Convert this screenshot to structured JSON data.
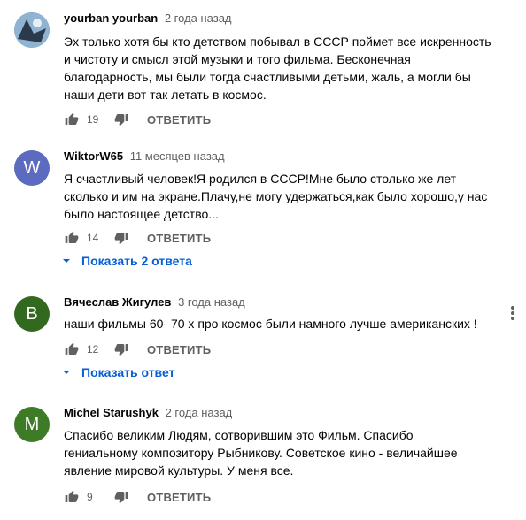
{
  "comments": [
    {
      "author": "yourban yourban",
      "date": "2 года назад",
      "avatar_letter": "",
      "avatar_color": "#7b9bb8",
      "text": "Эх только хотя бы кто детством побывал в СССР поймет все искренность\nи чистоту и смысл этой музыки и того фильма. Бесконечная\nблагодарность, мы были тогда счастливыми детьми, жаль, а могли бы\nнаши дети вот так летать в космос.",
      "likes": "19",
      "reply_label": "ОТВЕТИТЬ"
    },
    {
      "author": "WiktorW65",
      "date": "11 месяцев назад",
      "avatar_letter": "W",
      "avatar_color": "#5c6bc0",
      "text": "Я счастливый человек!Я родился в СССР!Мне было столько же лет\nсколько и им на экране.Плачу,не могу удержаться,как было хорошо,у нас\nбыло настоящее детство...",
      "likes": "14",
      "reply_label": "ОТВЕТИТЬ",
      "show_replies": "Показать 2 ответа"
    },
    {
      "author": "Вячеслав Жигулев",
      "date": "3 года назад",
      "avatar_letter": "В",
      "avatar_color": "#33691e",
      "text": "наши фильмы 60- 70 х  про космос были намного лучше американских !",
      "likes": "12",
      "reply_label": "ОТВЕТИТЬ",
      "show_replies": "Показать ответ"
    },
    {
      "author": "Michel Starushyk",
      "date": "2 года назад",
      "avatar_letter": "M",
      "avatar_color": "#3e7b27",
      "text": "Спасибо великим Людям, сотворившим это Фильм. Спасибо\nгениальному композитору Рыбникову. Советское кино - величайшее\nявление мировой культуры. У меня все.",
      "likes": "9",
      "reply_label": "ОТВЕТИТЬ"
    }
  ],
  "icons": {
    "like": "thumb-up-icon",
    "dislike": "thumb-down-icon",
    "expand": "chevron-down-icon",
    "menu": "more-vert-icon"
  }
}
